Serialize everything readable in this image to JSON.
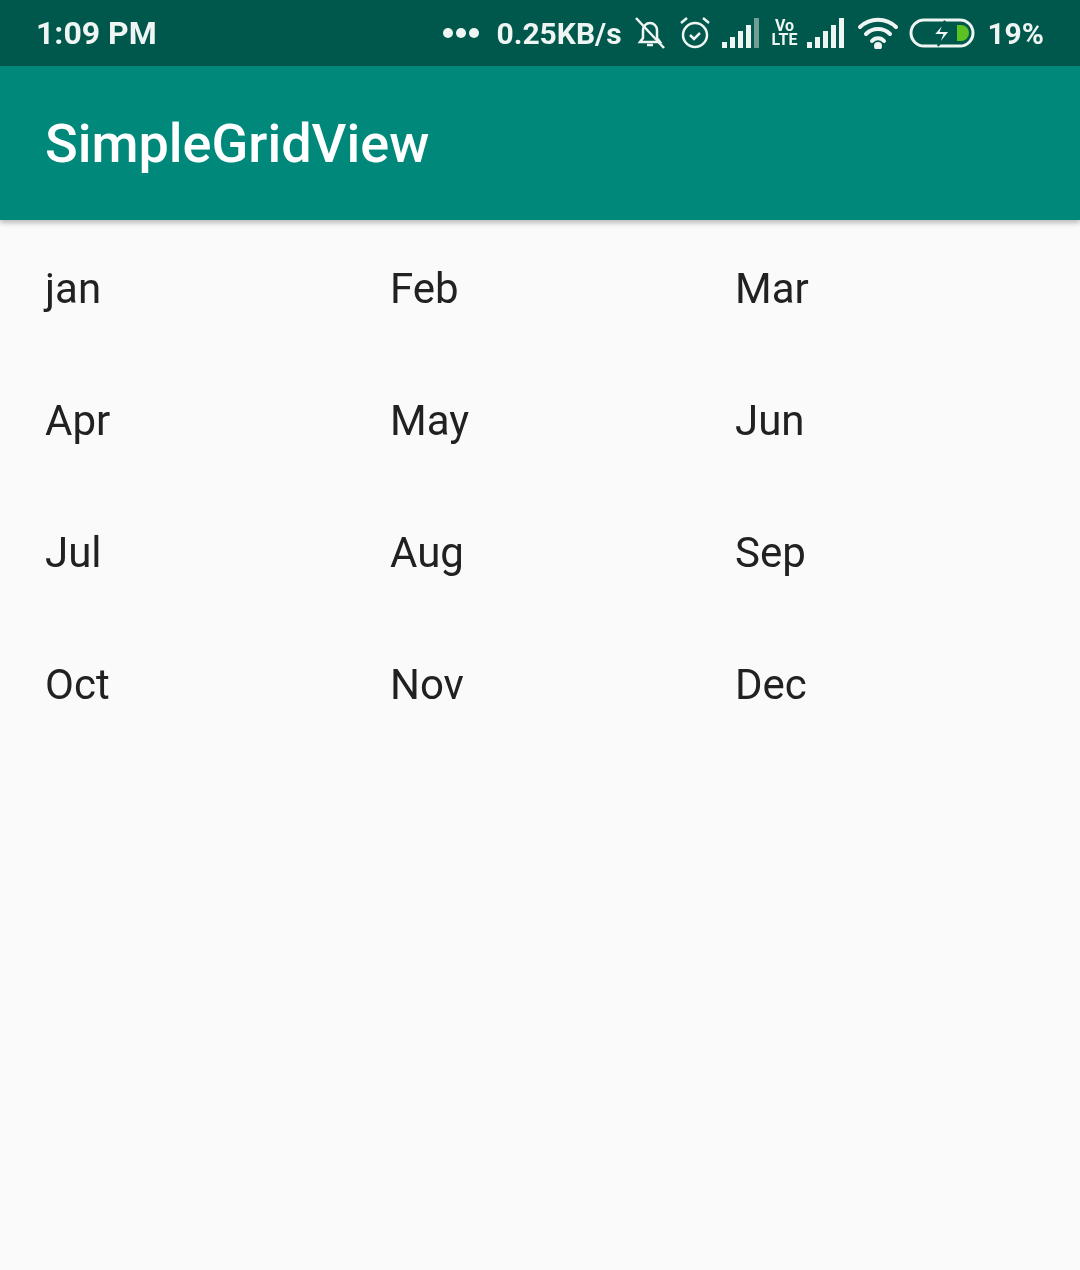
{
  "status_bar": {
    "time": "1:09 PM",
    "speed": "0.25KB/s",
    "volte_top": "Vo",
    "volte_bottom": "LTE",
    "battery": "19%"
  },
  "app_bar": {
    "title": "SimpleGridView"
  },
  "grid": {
    "items": [
      {
        "label": "jan"
      },
      {
        "label": "Feb"
      },
      {
        "label": "Mar"
      },
      {
        "label": "Apr"
      },
      {
        "label": "May"
      },
      {
        "label": "Jun"
      },
      {
        "label": "Jul"
      },
      {
        "label": "Aug"
      },
      {
        "label": "Sep"
      },
      {
        "label": "Oct"
      },
      {
        "label": "Nov"
      },
      {
        "label": "Dec"
      }
    ]
  }
}
